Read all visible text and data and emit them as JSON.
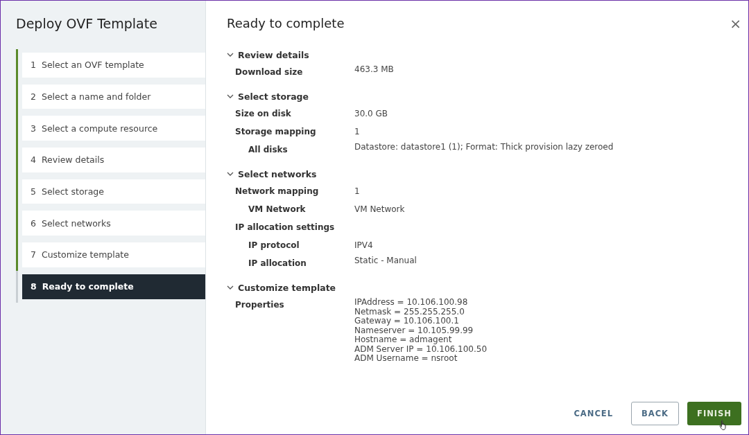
{
  "window": {
    "title": "Deploy OVF Template"
  },
  "steps": [
    {
      "number": "1",
      "label": "Select an OVF template",
      "selected": false,
      "completed": true
    },
    {
      "number": "2",
      "label": "Select a name and folder",
      "selected": false,
      "completed": true
    },
    {
      "number": "3",
      "label": "Select a compute resource",
      "selected": false,
      "completed": true
    },
    {
      "number": "4",
      "label": "Review details",
      "selected": false,
      "completed": true
    },
    {
      "number": "5",
      "label": "Select storage",
      "selected": false,
      "completed": true
    },
    {
      "number": "6",
      "label": "Select networks",
      "selected": false,
      "completed": true
    },
    {
      "number": "7",
      "label": "Customize template",
      "selected": false,
      "completed": true
    },
    {
      "number": "8",
      "label": "Ready to complete",
      "selected": true,
      "completed": false
    }
  ],
  "page": {
    "title": "Ready to complete",
    "close": "×"
  },
  "sections": [
    {
      "title": "Review details",
      "expanded": true,
      "rows": [
        {
          "label": "Download size",
          "value": [
            "463.3 MB"
          ]
        }
      ]
    },
    {
      "title": "Select storage",
      "expanded": true,
      "rows": [
        {
          "label": "Size on disk",
          "value": [
            "30.0 GB"
          ]
        },
        {
          "label": "Storage mapping",
          "value": [
            "1"
          ],
          "children": [
            {
              "label": "All disks",
              "value": [
                "Datastore: datastore1 (1); Format: Thick provision lazy zeroed"
              ]
            }
          ]
        }
      ]
    },
    {
      "title": "Select networks",
      "expanded": true,
      "rows": [
        {
          "label": "Network mapping",
          "value": [
            "1"
          ],
          "children": [
            {
              "label": "VM Network",
              "value": [
                "VM Network"
              ]
            }
          ]
        },
        {
          "label": "IP allocation settings",
          "children": [
            {
              "label": "IP protocol",
              "value": [
                "IPV4"
              ]
            },
            {
              "label": "IP allocation",
              "value": [
                "Static - Manual"
              ]
            }
          ]
        }
      ]
    },
    {
      "title": "Customize template",
      "expanded": true,
      "rows": [
        {
          "label": "Properties",
          "value": [
            "IPAddress = 10.106.100.98",
            "Netmask = 255.255.255.0",
            "Gateway = 10.106.100.1",
            "Nameserver = 10.105.99.99",
            "Hostname = admagent",
            "ADM Server IP = 10.106.100.50",
            "ADM Username = nsroot"
          ]
        }
      ]
    }
  ],
  "buttons": [
    {
      "label": "CANCEL",
      "kind": "flat"
    },
    {
      "label": "BACK",
      "kind": "outline"
    },
    {
      "label": "FINISH",
      "kind": "primary"
    }
  ]
}
